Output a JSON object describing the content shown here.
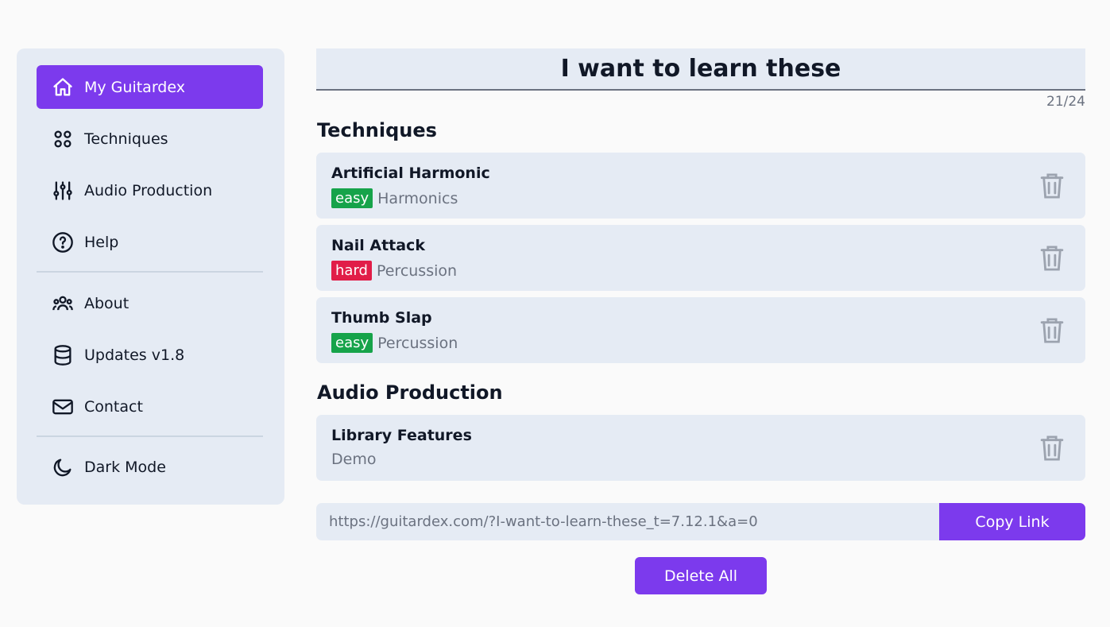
{
  "sidebar": {
    "items": [
      {
        "label": "My Guitardex",
        "icon": "home-icon",
        "active": true
      },
      {
        "label": "Techniques",
        "icon": "grid-icon"
      },
      {
        "label": "Audio Production",
        "icon": "sliders-icon"
      },
      {
        "label": "Help",
        "icon": "help-circle-icon"
      },
      {
        "label": "About",
        "icon": "users-icon"
      },
      {
        "label": "Updates v1.8",
        "icon": "database-icon"
      },
      {
        "label": "Contact",
        "icon": "mail-icon"
      },
      {
        "label": "Dark Mode",
        "icon": "moon-icon"
      }
    ]
  },
  "list": {
    "title": "I want to learn these",
    "counter": "21/24"
  },
  "sections": [
    {
      "heading": "Techniques",
      "cards": [
        {
          "title": "Artificial Harmonic",
          "badge": "easy",
          "category": "Harmonics"
        },
        {
          "title": "Nail Attack",
          "badge": "hard",
          "category": "Percussion"
        },
        {
          "title": "Thumb Slap",
          "badge": "easy",
          "category": "Percussion"
        }
      ]
    },
    {
      "heading": "Audio Production",
      "cards": [
        {
          "title": "Library Features",
          "category": "Demo"
        }
      ]
    }
  ],
  "share": {
    "link": "https://guitardex.com/?I-want-to-learn-these_t=7.12.1&a=0",
    "copy_label": "Copy Link"
  },
  "delete_all_label": "Delete All",
  "colors": {
    "accent": "#7c3aed",
    "easy": "#16a34a",
    "hard": "#e11d48",
    "panel": "#e5ebf4"
  }
}
